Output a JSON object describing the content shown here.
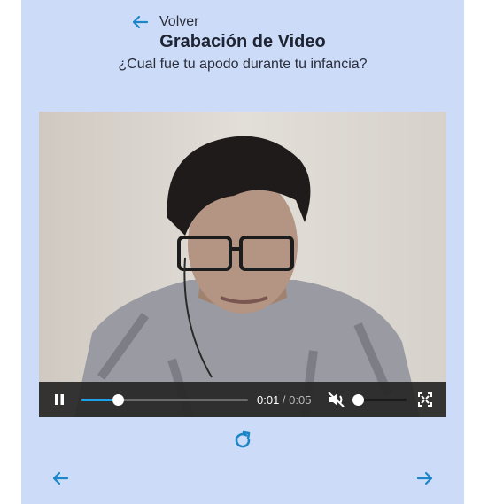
{
  "header": {
    "back_label": "Volver",
    "title": "Grabación de Video",
    "question": "¿Cual fue tu apodo durante tu infancia?"
  },
  "player": {
    "current_time": "0:01",
    "separator": " / ",
    "duration": "0:05",
    "progress_fraction": 0.22,
    "volume_fraction": 0.0,
    "muted": true,
    "state": "playing"
  },
  "icons": {
    "back": "arrow-left-icon",
    "pause": "pause-icon",
    "mute": "volume-muted-icon",
    "fullscreen": "fullscreen-icon",
    "retry": "refresh-icon",
    "prev": "arrow-left-icon",
    "next": "arrow-right-icon"
  },
  "colors": {
    "accent": "#1a86c8",
    "panel": "#ccdcf8",
    "progress": "#1aa4e6"
  }
}
